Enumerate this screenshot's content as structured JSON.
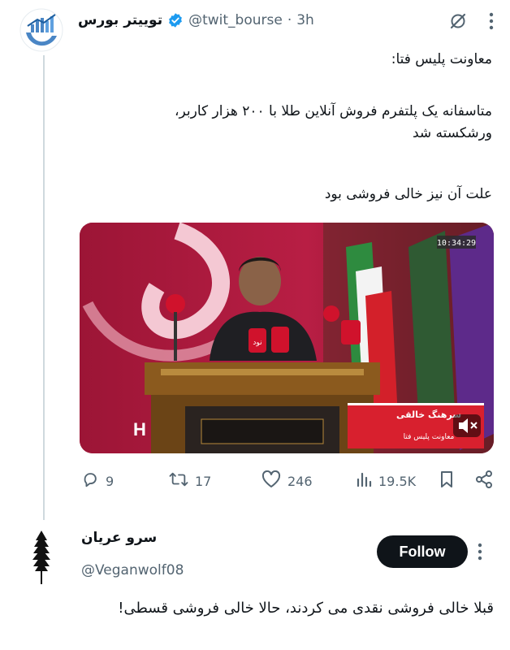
{
  "tweet": {
    "author_name": "توییتر بورس",
    "handle": "@twit_bourse",
    "separator": "·",
    "time": "3h",
    "text_line1": "معاونت پلیس فتا:",
    "text_line2": "متاسفانه یک پلتفرم فروش آنلاین طلا با ۲۰۰ هزار کاربر،",
    "text_line3": "ورشکسته شد",
    "text_line4": "علت آن نیز خالی فروشی بود",
    "media": {
      "timestamp": "10:34:29",
      "caption_name": "سرهنگ خالقی",
      "caption_title": "معاونت پلیس فتا",
      "mic_label": "نود",
      "mute_icon": "speaker-muted-icon"
    },
    "stats": {
      "replies": "9",
      "retweets": "17",
      "likes": "246",
      "views": "19.5K"
    },
    "icons": [
      "grok-icon",
      "more-icon",
      "reply-icon",
      "retweet-icon",
      "like-icon",
      "views-icon",
      "bookmark-icon",
      "share-icon"
    ]
  },
  "reply": {
    "author_name": "سرو عریان",
    "handle": "@Veganwolf08",
    "follow_label": "Follow",
    "text": "قبلا خالی فروشی نقدی می کردند، حالا خالی فروشی قسطی!"
  },
  "colors": {
    "verified": "#1d9bf0",
    "text_primary": "#0f1419",
    "text_secondary": "#536471",
    "follow_bg": "#0f1419",
    "caption_red": "#d8202e"
  }
}
